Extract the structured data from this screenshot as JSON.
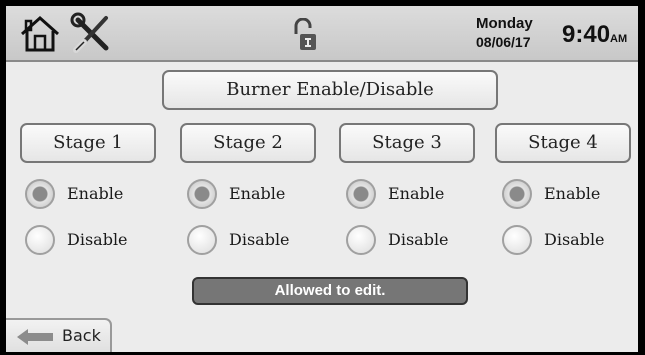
{
  "header": {
    "day": "Monday",
    "date": "08/06/17",
    "time": "9:40",
    "ampm": "AM"
  },
  "title": "Burner Enable/Disable",
  "stages": [
    {
      "label": "Stage 1",
      "enable_label": "Enable",
      "disable_label": "Disable",
      "selected": "enable"
    },
    {
      "label": "Stage 2",
      "enable_label": "Enable",
      "disable_label": "Disable",
      "selected": "enable"
    },
    {
      "label": "Stage 3",
      "enable_label": "Enable",
      "disable_label": "Disable",
      "selected": "enable"
    },
    {
      "label": "Stage 4",
      "enable_label": "Enable",
      "disable_label": "Disable",
      "selected": "enable"
    }
  ],
  "status_text": "Allowed to edit.",
  "back_label": "Back",
  "icons": {
    "home": "home-icon",
    "tools": "tools-icon",
    "lock": "unlocked-icon",
    "back": "back-arrow-icon"
  }
}
